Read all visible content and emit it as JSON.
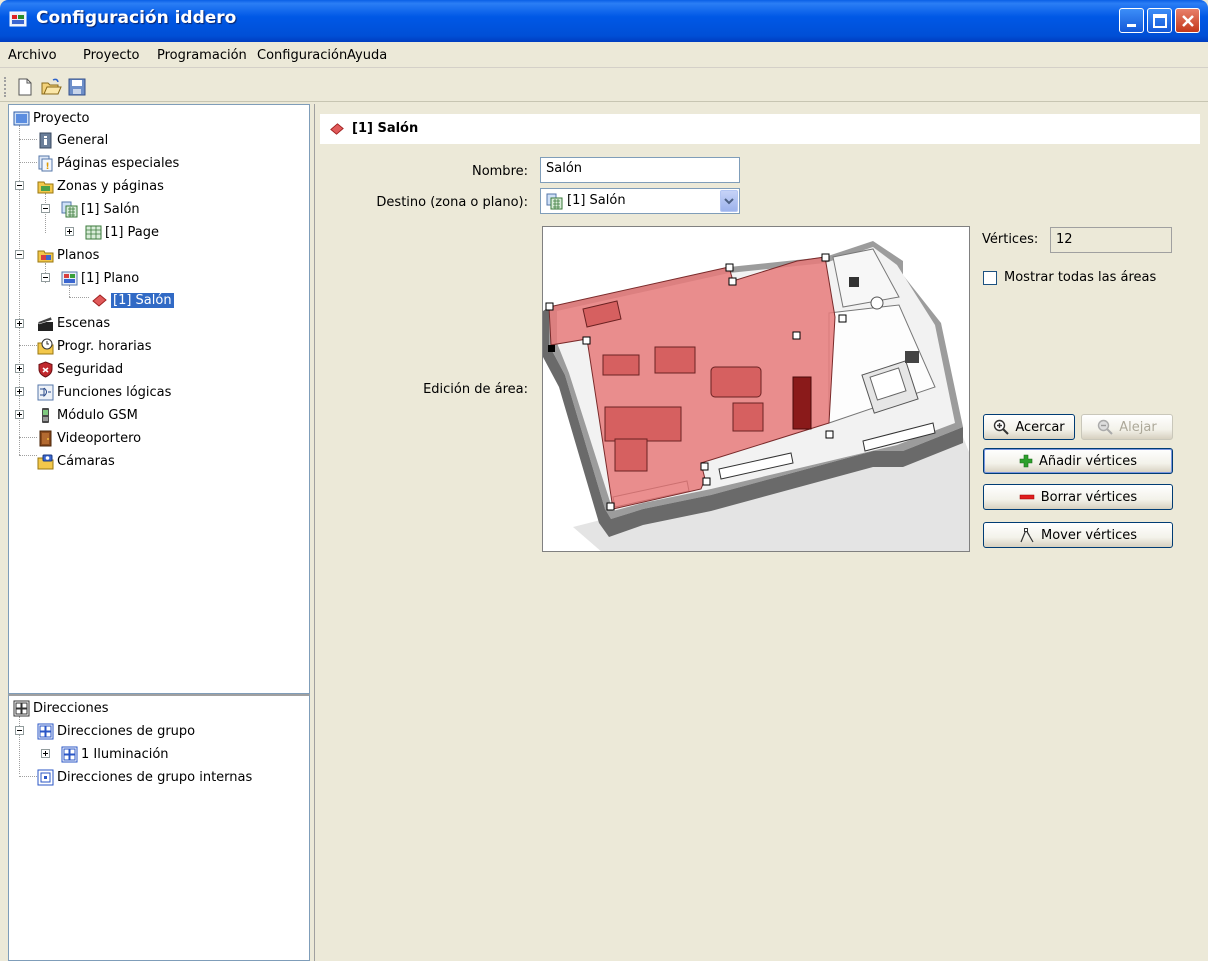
{
  "window": {
    "title": "Configuración iddero",
    "accent": "#0058e6"
  },
  "menu": [
    "Archivo",
    "Proyecto",
    "Programación",
    "Configuración",
    "Ayuda"
  ],
  "toolbar": {
    "icons": [
      "new-file-icon",
      "open-folder-icon",
      "save-icon"
    ]
  },
  "project_tree": {
    "root": "Proyecto",
    "general": "General",
    "special_pages": "Páginas especiales",
    "zones": "Zonas y páginas",
    "zone_salon": "[1] Salón",
    "page": "[1] Page",
    "plans": "Planos",
    "plan": "[1] Plano",
    "plan_area": "[1] Salón",
    "scenes": "Escenas",
    "schedules": "Progr. horarias",
    "security": "Seguridad",
    "logic": "Funciones lógicas",
    "gsm": "Módulo GSM",
    "video": "Videoportero",
    "cameras": "Cámaras"
  },
  "address_tree": {
    "root": "Direcciones",
    "group": "Direcciones de grupo",
    "lighting": "1 Iluminación",
    "internal": "Direcciones de grupo internas"
  },
  "editor": {
    "header_title": "[1] Salón",
    "name_label": "Nombre:",
    "name_value": "Salón",
    "dest_label": "Destino (zona o plano):",
    "dest_value": "[1] Salón",
    "area_label": "Edición de área:",
    "vertices_label": "Vértices:",
    "vertices_value": "12",
    "show_all_label": "Mostrar todas las áreas",
    "show_all_checked": false,
    "zoom_in": "Acercar",
    "zoom_out": "Alejar",
    "add_vertices": "Añadir vértices",
    "delete_vertices": "Borrar vértices",
    "move_vertices": "Mover vértices",
    "area_color": "#ea7a7a"
  }
}
